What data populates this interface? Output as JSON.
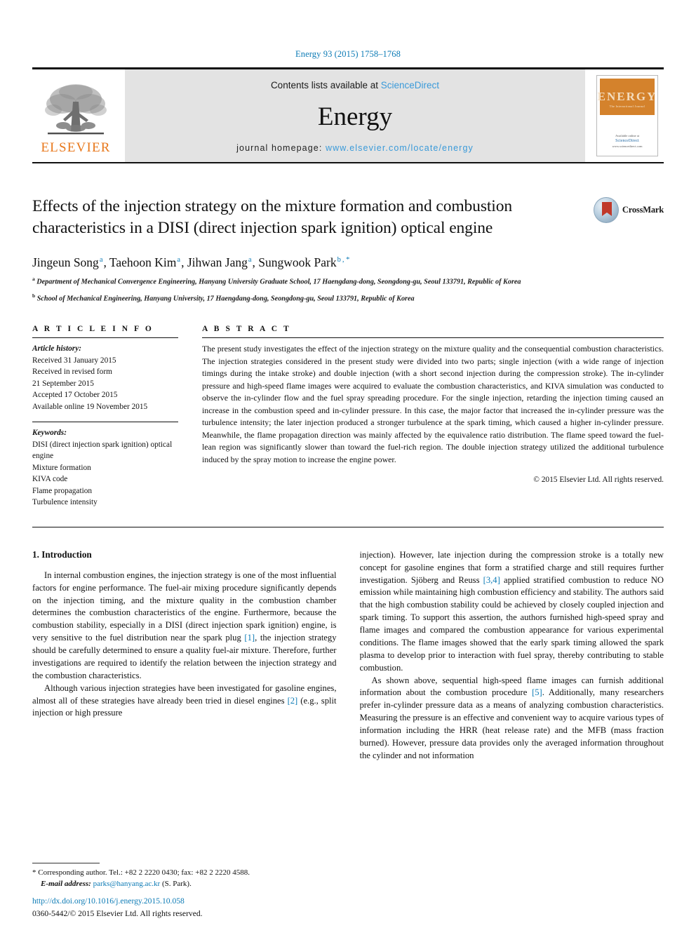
{
  "running_head": "Energy 93 (2015) 1758–1768",
  "masthead": {
    "publisher_name": "ELSEVIER",
    "contents_prefix": "Contents lists available at ",
    "contents_link": "ScienceDirect",
    "journal_title": "Energy",
    "homepage_prefix": "journal homepage: ",
    "homepage_url": "www.elsevier.com/locate/energy",
    "cover_title": "ENERGY",
    "cover_subtitle": "The International Journal",
    "cover_footer_prefix": "Available online at",
    "cover_footer_link": "ScienceDirect",
    "cover_footer_url": "www.sciencedirect.com"
  },
  "crossmark": {
    "label": "CrossMark"
  },
  "article": {
    "title": "Effects of the injection strategy on the mixture formation and combustion characteristics in a DISI (direct injection spark ignition) optical engine",
    "authors": [
      {
        "name": "Jingeun Song",
        "sup": "a",
        "sep": ", "
      },
      {
        "name": "Taehoon Kim",
        "sup": "a",
        "sep": ", "
      },
      {
        "name": "Jihwan Jang",
        "sup": "a",
        "sep": ", "
      },
      {
        "name": "Sungwook Park",
        "sup": "b",
        "sep": "",
        "corresponding": true
      }
    ],
    "affiliations": [
      {
        "mark": "a",
        "text": "Department of Mechanical Convergence Engineering, Hanyang University Graduate School, 17 Haengdang-dong, Seongdong-gu, Seoul 133791, Republic of Korea"
      },
      {
        "mark": "b",
        "text": "School of Mechanical Engineering, Hanyang University, 17 Haengdang-dong, Seongdong-gu, Seoul 133791, Republic of Korea"
      }
    ]
  },
  "article_info": {
    "heading": "A R T I C L E  I N F O",
    "history_label": "Article history:",
    "history": [
      "Received 31 January 2015",
      "Received in revised form",
      "21 September 2015",
      "Accepted 17 October 2015",
      "Available online 19 November 2015"
    ],
    "keywords_label": "Keywords:",
    "keywords": [
      "DISI (direct injection spark ignition) optical engine",
      "Mixture formation",
      "KIVA code",
      "Flame propagation",
      "Turbulence intensity"
    ]
  },
  "abstract": {
    "heading": "A B S T R A C T",
    "text": "The present study investigates the effect of the injection strategy on the mixture quality and the consequential combustion characteristics. The injection strategies considered in the present study were divided into two parts; single injection (with a wide range of injection timings during the intake stroke) and double injection (with a short second injection during the compression stroke). The in-cylinder pressure and high-speed flame images were acquired to evaluate the combustion characteristics, and KIVA simulation was conducted to observe the in-cylinder flow and the fuel spray spreading procedure. For the single injection, retarding the injection timing caused an increase in the combustion speed and in-cylinder pressure. In this case, the major factor that increased the in-cylinder pressure was the turbulence intensity; the later injection produced a stronger turbulence at the spark timing, which caused a higher in-cylinder pressure. Meanwhile, the flame propagation direction was mainly affected by the equivalence ratio distribution. The flame speed toward the fuel-lean region was significantly slower than toward the fuel-rich region. The double injection strategy utilized the additional turbulence induced by the spray motion to increase the engine power.",
    "copyright": "© 2015 Elsevier Ltd. All rights reserved."
  },
  "body": {
    "section_title": "1. Introduction",
    "left_paragraphs": [
      {
        "parts": [
          {
            "t": "In internal combustion engines, the injection strategy is one of the most influential factors for engine performance. The fuel-air mixing procedure significantly depends on the injection timing, and the mixture quality in the combustion chamber determines the combustion characteristics of the engine. Furthermore, because the combustion stability, especially in a DISI (direct injection spark ignition) engine, is very sensitive to the fuel distribution near the spark plug "
          },
          {
            "t": "[1]",
            "ref": true
          },
          {
            "t": ", the injection strategy should be carefully determined to ensure a quality fuel-air mixture. Therefore, further investigations are required to identify the relation between the injection strategy and the combustion characteristics."
          }
        ]
      },
      {
        "parts": [
          {
            "t": "Although various injection strategies have been investigated for gasoline engines, almost all of these strategies have already been tried in diesel engines "
          },
          {
            "t": "[2]",
            "ref": true
          },
          {
            "t": " (e.g., split injection or high pressure"
          }
        ]
      }
    ],
    "right_paragraphs": [
      {
        "continued": true,
        "parts": [
          {
            "t": "injection). However, late injection during the compression stroke is a totally new concept for gasoline engines that form a stratified charge and still requires further investigation. Sjöberg and Reuss "
          },
          {
            "t": "[3,4]",
            "ref": true
          },
          {
            "t": " applied stratified combustion to reduce NO emission while maintaining high combustion efficiency and stability. The authors said that the high combustion stability could be achieved by closely coupled injection and spark timing. To support this assertion, the authors furnished high-speed spray and flame images and compared the combustion appearance for various experimental conditions. The flame images showed that the early spark timing allowed the spark plasma to develop prior to interaction with fuel spray, thereby contributing to stable combustion."
          }
        ]
      },
      {
        "parts": [
          {
            "t": "As shown above, sequential high-speed flame images can furnish additional information about the combustion procedure "
          },
          {
            "t": "[5]",
            "ref": true
          },
          {
            "t": ". Additionally, many researchers prefer in-cylinder pressure data as a means of analyzing combustion characteristics. Measuring the pressure is an effective and convenient way to acquire various types of information including the HRR (heat release rate) and the MFB (mass fraction burned). However, pressure data provides only the averaged information throughout the cylinder and not information"
          }
        ]
      }
    ]
  },
  "footnote": {
    "marker": "*",
    "line1": "Corresponding author. Tel.: +82 2 2220 0430; fax: +82 2 2220 4588.",
    "email_label": "E-mail address:",
    "email": "parks@hanyang.ac.kr",
    "email_suffix": "(S. Park)."
  },
  "doi_block": {
    "doi": "http://dx.doi.org/10.1016/j.energy.2015.10.058",
    "issn_line": "0360-5442/© 2015 Elsevier Ltd. All rights reserved."
  },
  "colors": {
    "link": "#0b7ab5",
    "elsevier_orange": "#e8781c",
    "masthead_grey": "#e3e3e3"
  }
}
